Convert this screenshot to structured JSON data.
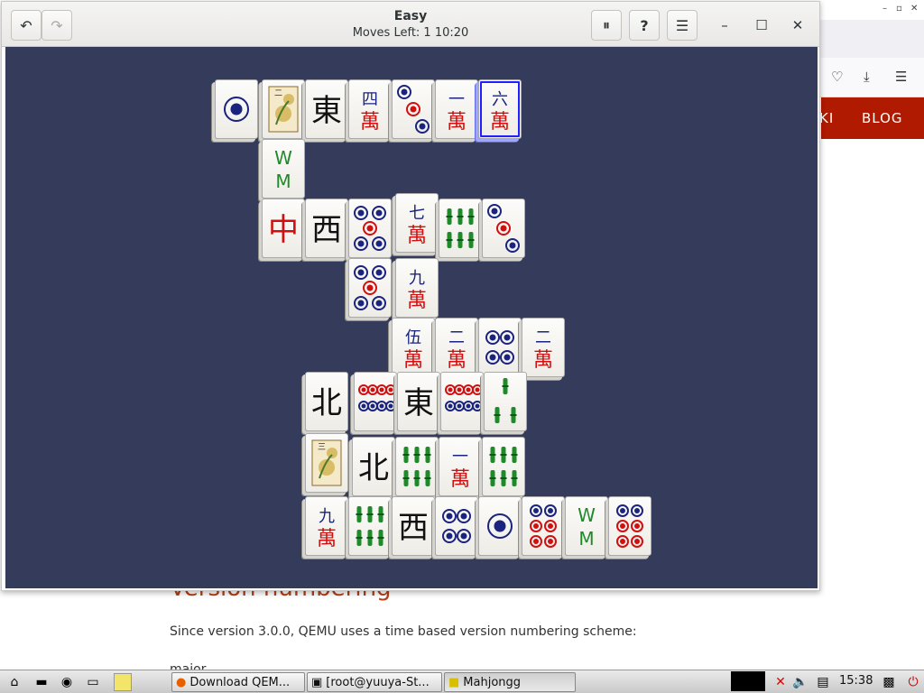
{
  "window": {
    "title": "Easy",
    "subtitle": "Moves Left:  1   10:20",
    "buttons": {
      "undo": "↶",
      "redo": "↷",
      "pause": "⏸",
      "help": "?",
      "menu": "☰",
      "minimize": "–",
      "maximize": "☐",
      "close": "✕"
    }
  },
  "browser": {
    "nav_left": "KI",
    "nav_blog": "BLOG",
    "heading": "Version numbering",
    "paragraph": "Since version 3.0.0, QEMU uses a time based version numbering scheme:",
    "paragraph2": "major",
    "toolbar_icons": [
      "pocket-icon",
      "download-icon",
      "menu-icon"
    ]
  },
  "board": {
    "colors": {
      "felt": "#343b5b",
      "red": "#d01010",
      "blue": "#1a237e",
      "green": "#1f8a2a"
    },
    "tiles": [
      {
        "face": "dot1",
        "label": ""
      },
      {
        "face": "flower",
        "label": "二"
      },
      {
        "face": "char",
        "label": "東"
      },
      {
        "face": "wan",
        "label": "四"
      },
      {
        "face": "dot3",
        "label": ""
      },
      {
        "face": "wan",
        "label": "一"
      },
      {
        "face": "wan",
        "label": "六",
        "selected": true
      },
      {
        "face": "bam",
        "label": ""
      },
      {
        "face": "red",
        "label": "中"
      },
      {
        "face": "char",
        "label": "西"
      },
      {
        "face": "dot5",
        "label": ""
      },
      {
        "face": "wan",
        "label": "七"
      },
      {
        "face": "bam6",
        "label": ""
      },
      {
        "face": "dot3",
        "label": ""
      },
      {
        "face": "dot5",
        "label": ""
      },
      {
        "face": "wan",
        "label": "九"
      },
      {
        "face": "wan",
        "label": "伍"
      },
      {
        "face": "wan",
        "label": "二"
      },
      {
        "face": "dot4",
        "label": ""
      },
      {
        "face": "wan",
        "label": "二"
      },
      {
        "face": "char",
        "label": "北"
      },
      {
        "face": "dot8",
        "label": ""
      },
      {
        "face": "char",
        "label": "東"
      },
      {
        "face": "dot8",
        "label": ""
      },
      {
        "face": "bam3",
        "label": ""
      },
      {
        "face": "flower",
        "label": "三"
      },
      {
        "face": "char",
        "label": "北"
      },
      {
        "face": "bam6",
        "label": ""
      },
      {
        "face": "wan",
        "label": "一"
      },
      {
        "face": "bam6",
        "label": ""
      },
      {
        "face": "wan",
        "label": "九"
      },
      {
        "face": "bam6",
        "label": ""
      },
      {
        "face": "char",
        "label": "西"
      },
      {
        "face": "dot4",
        "label": ""
      },
      {
        "face": "dot1",
        "label": ""
      },
      {
        "face": "dot6",
        "label": ""
      },
      {
        "face": "bam",
        "label": ""
      },
      {
        "face": "dot6",
        "label": ""
      }
    ]
  },
  "taskbar": {
    "items": [
      {
        "label": "Download QEM...",
        "icon": "firefox-icon"
      },
      {
        "label": "[root@yuuya-St...",
        "icon": "terminal-icon"
      },
      {
        "label": "Mahjongg",
        "icon": "mahjongg-icon",
        "active": true
      }
    ],
    "clock": "15:38"
  }
}
